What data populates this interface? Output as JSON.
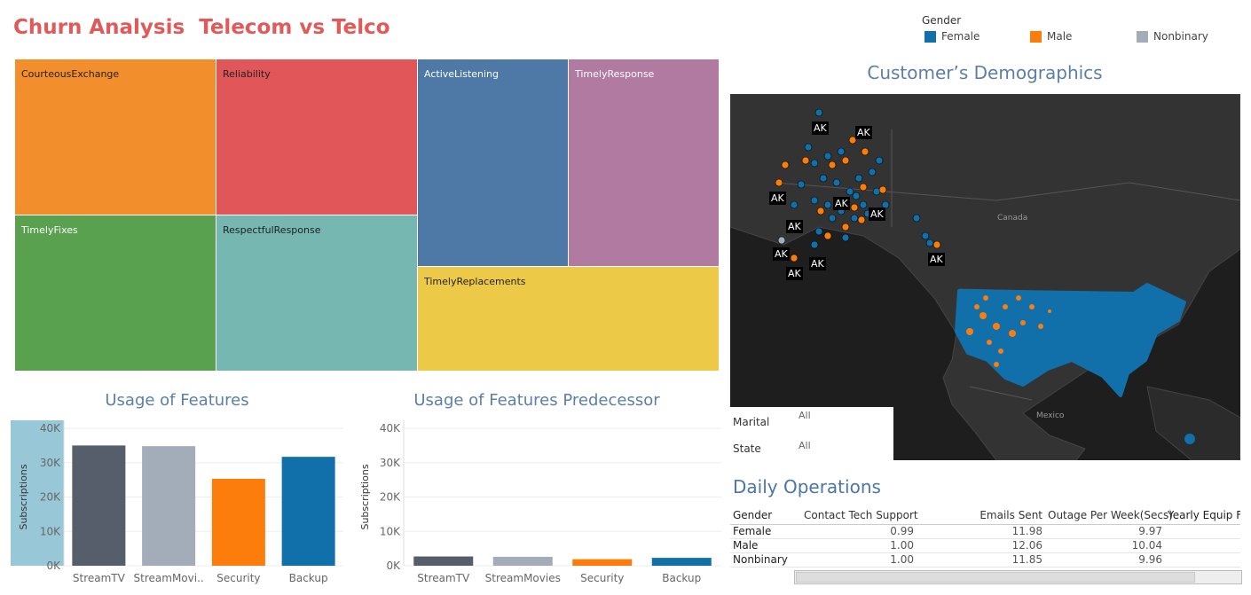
{
  "title": "Churn Analysis  Telecom vs Telco",
  "legend": {
    "title": "Gender",
    "items": [
      {
        "label": "Female",
        "color": "#1170aa"
      },
      {
        "label": "Male",
        "color": "#fc7d0b"
      },
      {
        "label": "Nonbinary",
        "color": "#a3acb9"
      }
    ]
  },
  "treemap": {
    "tiles": [
      {
        "label": "CourteousExchange",
        "color": "#f28e2b"
      },
      {
        "label": "Reliability",
        "color": "#e15759"
      },
      {
        "label": "ActiveListening",
        "color": "#4e79a7"
      },
      {
        "label": "TimelyResponse",
        "color": "#b07aa1"
      },
      {
        "label": "TimelyFixes",
        "color": "#59a14f"
      },
      {
        "label": "RespectfulResponse",
        "color": "#76b7b2"
      },
      {
        "label": "TimelyReplacements",
        "color": "#edc948"
      }
    ]
  },
  "demographics": {
    "title": "Customer’s Demographics",
    "ak_label": "AK",
    "canada_label": "Canada",
    "mexico_label": "Mexico"
  },
  "filters": [
    {
      "label": "Marital",
      "value": "All"
    },
    {
      "label": "State",
      "value": "All"
    }
  ],
  "daily_operations": {
    "title": "Daily Operations",
    "columns": [
      "Gender",
      "Contact Tech Support",
      "Emails Sent",
      "Outage Per Week(Secs)",
      "Yearly Equip F"
    ],
    "rows": [
      [
        "Female",
        "0.99",
        "11.98",
        "9.97",
        ""
      ],
      [
        "Male",
        "1.00",
        "12.06",
        "10.04",
        ""
      ],
      [
        "Nonbinary",
        "1.00",
        "11.85",
        "9.96",
        ""
      ]
    ]
  },
  "chart_data": [
    {
      "type": "bar",
      "title": "Usage of Features",
      "ylabel": "Subscriptions",
      "categories": [
        "StreamTV",
        "StreamMovi..",
        "Security",
        "Backup"
      ],
      "values": [
        35000,
        34800,
        25300,
        31700
      ],
      "colors": [
        "#575e6b",
        "#a3acb9",
        "#fc7d0b",
        "#1170aa"
      ],
      "yticks": [
        "0K",
        "10K",
        "20K",
        "30K",
        "40K"
      ],
      "ylim": [
        0,
        40000
      ],
      "grid": true
    },
    {
      "type": "bar",
      "title": "Usage of Features Predecessor",
      "ylabel": "Subscriptions",
      "categories": [
        "StreamTV",
        "StreamMovies",
        "Security",
        "Backup"
      ],
      "values": [
        2700,
        2600,
        1900,
        2300
      ],
      "colors": [
        "#575e6b",
        "#a3acb9",
        "#fc7d0b",
        "#1170aa"
      ],
      "yticks": [
        "0K",
        "10K",
        "20K",
        "30K",
        "40K"
      ],
      "ylim": [
        0,
        40000
      ],
      "grid": true
    }
  ]
}
